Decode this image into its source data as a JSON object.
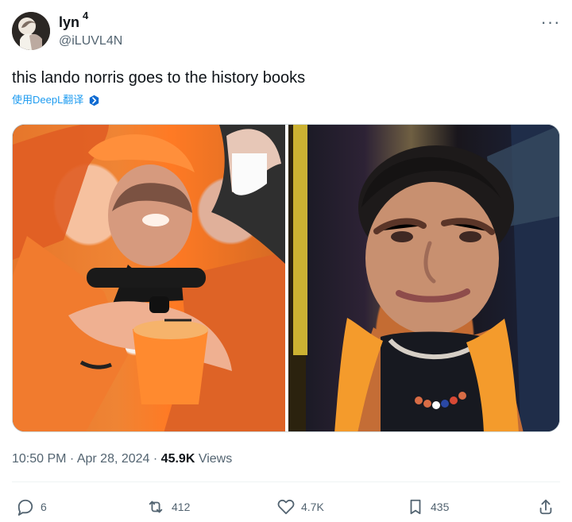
{
  "user": {
    "display_name": "lyn",
    "superscript": "4",
    "handle": "@iLUVL4N"
  },
  "tweet": {
    "text": "this lando norris goes to the history books",
    "translate_link": "使用DeepL翻译",
    "timestamp": "10:50 PM · Apr 28, 2024 · ",
    "views": "45.9K",
    "views_label": " Views"
  },
  "actions": {
    "reply_count": "6",
    "retweet_count": "412",
    "like_count": "4.7K",
    "bookmark_count": "435"
  },
  "icons": {
    "avatar": "profile-photo",
    "more": "more-icon",
    "translate": "deepl-icon",
    "reply": "reply-icon",
    "retweet": "retweet-icon",
    "like": "like-icon",
    "bookmark": "bookmark-icon",
    "share": "share-icon"
  },
  "colors": {
    "text": "#0f1419",
    "secondary": "#536471",
    "link": "#1d9bf0",
    "border": "#cfd9de"
  }
}
